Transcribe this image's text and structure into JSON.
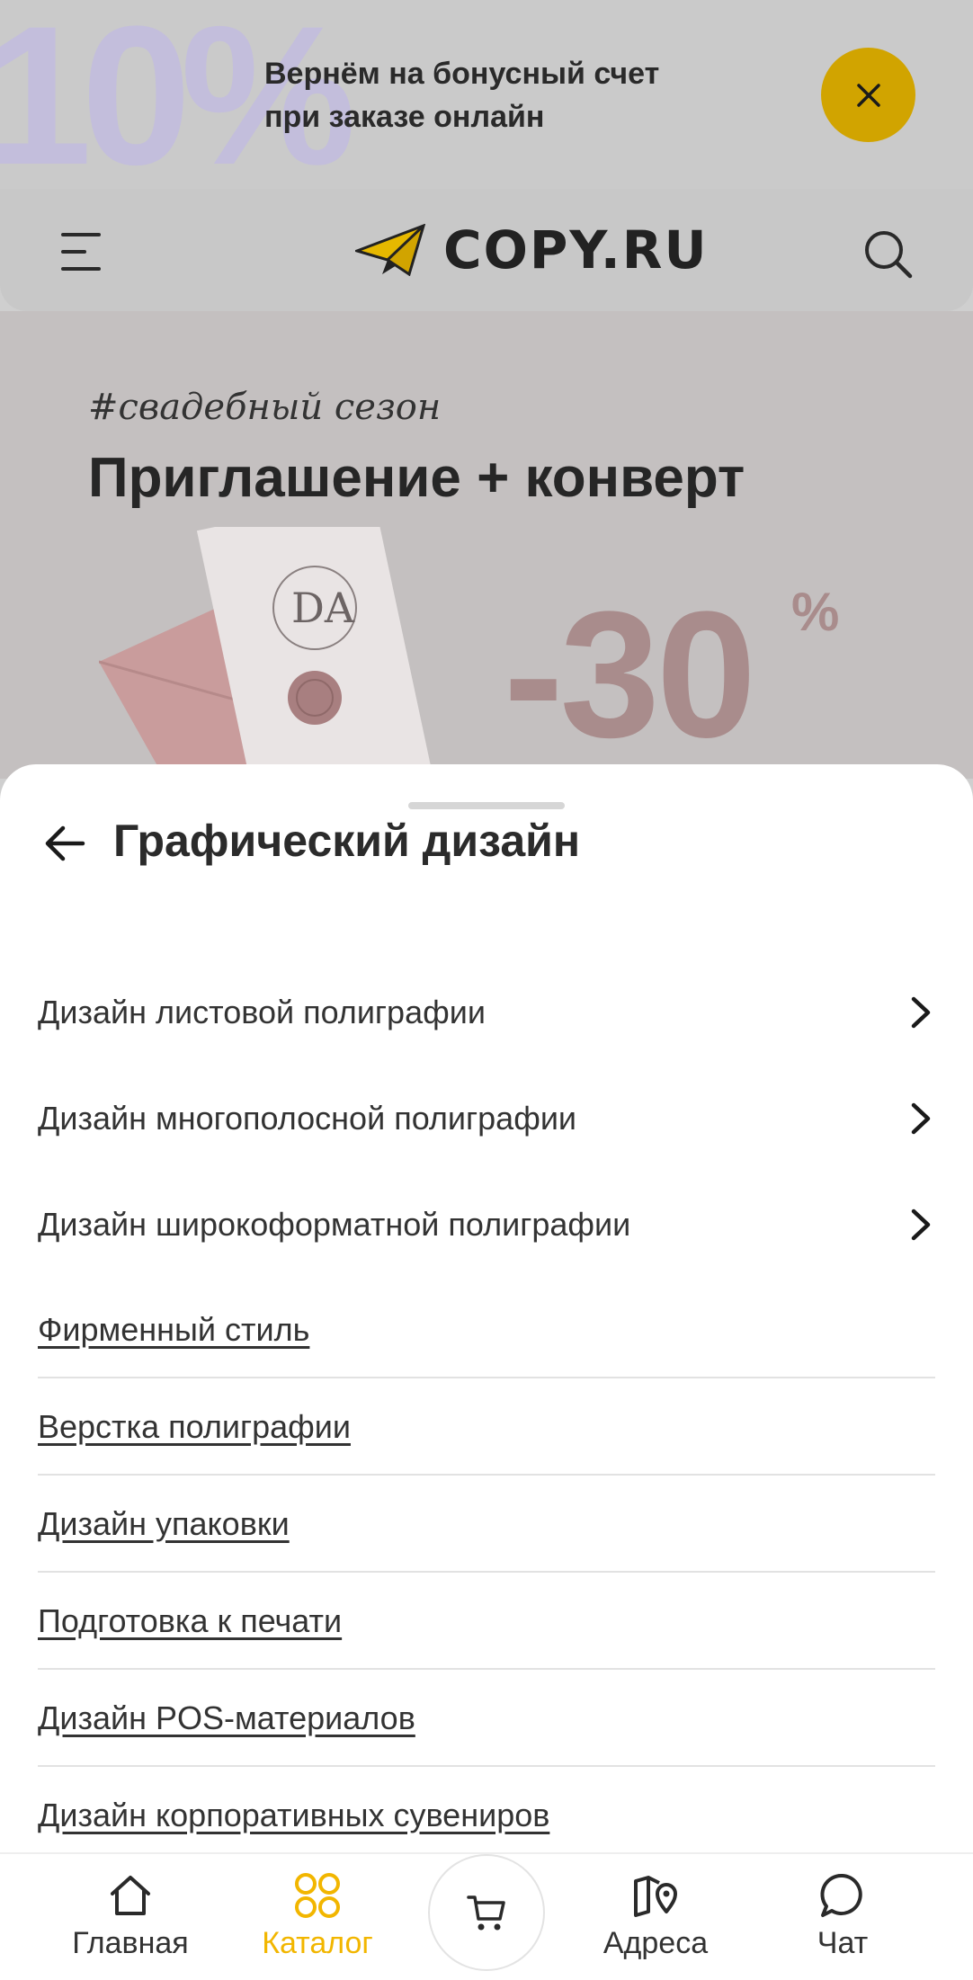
{
  "promo": {
    "badge": "10%",
    "line1": "Вернём на бонусный счет",
    "line2": "при заказе онлайн",
    "close_icon": "close-icon",
    "accent": "#d1a400"
  },
  "header": {
    "logo_text": "COPY.RU",
    "menu_icon": "hamburger-icon",
    "search_icon": "search-icon"
  },
  "hero": {
    "tag": "#свадебный сезон",
    "title": "Приглашение + конверт",
    "discount": "-30",
    "percent": "%",
    "monogram": "DA"
  },
  "sheet": {
    "title": "Графический дизайн",
    "submenus": [
      {
        "label": "Дизайн листовой полиграфии"
      },
      {
        "label": "Дизайн многополосной полиграфии"
      },
      {
        "label": "Дизайн широкоформатной полиграфии"
      }
    ],
    "links": [
      {
        "label": "Фирменный стиль"
      },
      {
        "label": "Верстка полиграфии"
      },
      {
        "label": "Дизайн упаковки"
      },
      {
        "label": "Подготовка к печати"
      },
      {
        "label": "Дизайн POS-материалов"
      },
      {
        "label": "Дизайн корпоративных сувениров"
      }
    ]
  },
  "nav": {
    "home": "Главная",
    "catalog": "Каталог",
    "cart_icon": "cart-icon",
    "addresses": "Адреса",
    "chat": "Чат",
    "active": "catalog",
    "active_color": "#f2b600"
  }
}
